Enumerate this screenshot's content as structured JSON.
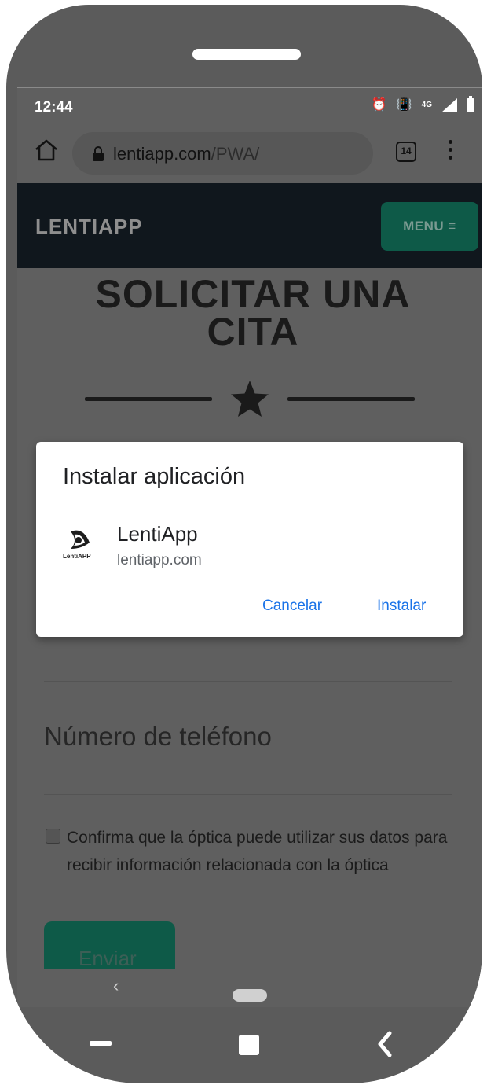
{
  "status_bar": {
    "time": "12:44",
    "network": "4G"
  },
  "browser": {
    "url_domain": "lentiapp.com",
    "url_path": "/PWA/",
    "tab_count": "14"
  },
  "site": {
    "brand": "LENTIAPP",
    "menu_label": "MENU ≡"
  },
  "page": {
    "heading_line1": "SOLICITAR UNA",
    "heading_line2": "CITA",
    "phone_placeholder": "Número de teléfono",
    "consent_text": "Confirma que la óptica puede utilizar sus datos para recibir información relacionada con la óptica",
    "send_label": "Enviar"
  },
  "dialog": {
    "title": "Instalar aplicación",
    "app_name": "LentiApp",
    "app_domain": "lentiapp.com",
    "logo_text": "LentiAPP",
    "cancel_label": "Cancelar",
    "install_label": "Instalar"
  },
  "colors": {
    "accent_green": "#0e5a48",
    "link_blue": "#1a73e8",
    "header_dark": "#10171d"
  }
}
